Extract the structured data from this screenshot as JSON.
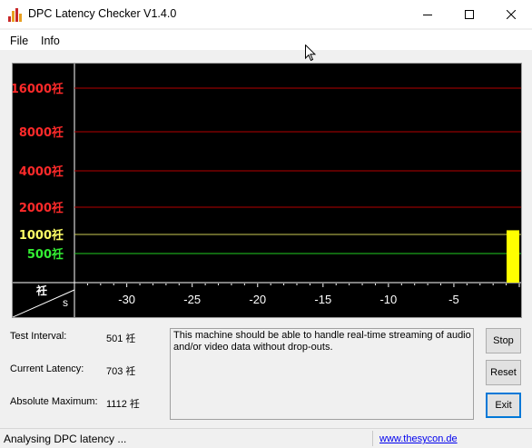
{
  "window": {
    "title": "DPC Latency Checker V1.4.0",
    "icon": "app-bars-icon"
  },
  "menu": {
    "items": [
      "File",
      "Info"
    ]
  },
  "chart_data": {
    "type": "bar",
    "title": "",
    "xlabel": "s",
    "ylabel": "祍",
    "x_ticks": [
      -30,
      -25,
      -20,
      -15,
      -10,
      -5
    ],
    "xlim": [
      -34,
      0
    ],
    "y_ticks": [
      {
        "label": "16000祍",
        "value": 16000,
        "color": "#ff2a2a",
        "line": "#b40000"
      },
      {
        "label": "8000祍",
        "value": 8000,
        "color": "#ff2a2a",
        "line": "#b40000"
      },
      {
        "label": "4000祍",
        "value": 4000,
        "color": "#ff2a2a",
        "line": "#b40000"
      },
      {
        "label": "2000祍",
        "value": 2000,
        "color": "#ff2a2a",
        "line": "#b40000"
      },
      {
        "label": "1000祍",
        "value": 1000,
        "color": "#ffff66",
        "line": "#cccc55"
      },
      {
        "label": "500祍",
        "value": 500,
        "color": "#33ee33",
        "line": "#22cc22"
      }
    ],
    "series": [
      {
        "x": [
          0
        ],
        "values": [
          1112
        ],
        "color": "#ffff00"
      }
    ],
    "grid": true
  },
  "info": {
    "test_interval_label": "Test Interval:",
    "test_interval_value": "501 祍",
    "current_latency_label": "Current Latency:",
    "current_latency_value": "703 祍",
    "absolute_max_label": "Absolute Maximum:",
    "absolute_max_value": "1112 祍"
  },
  "message": "This machine should be able to handle real-time streaming of audio and/or video data without drop-outs.",
  "buttons": {
    "stop": "Stop",
    "reset": "Reset",
    "exit": "Exit"
  },
  "status": {
    "text": "Analysing DPC latency ...",
    "link": "www.thesycon.de"
  }
}
